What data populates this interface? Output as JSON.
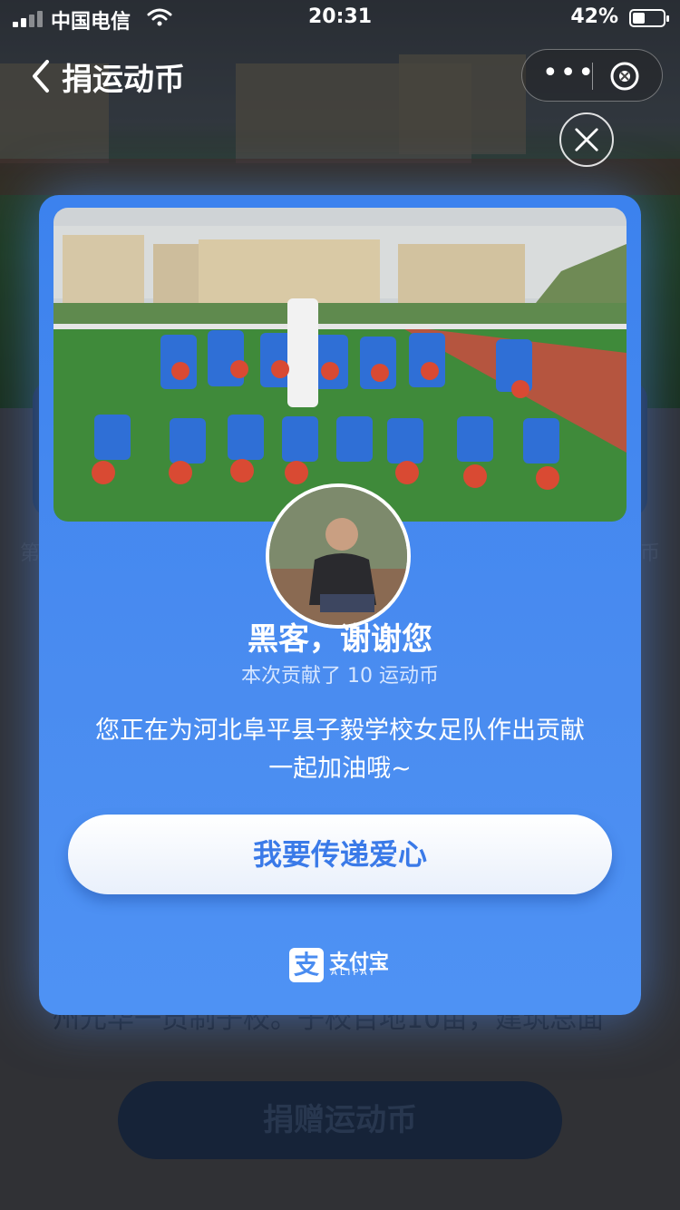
{
  "status_bar": {
    "carrier": "中国电信",
    "time": "20:31",
    "battery_percent": "42%",
    "battery_level": 0.42
  },
  "nav": {
    "title": "捐运动币",
    "back_icon": "chevron-left-icon",
    "more_icon": "more-dots-icon",
    "close_icon": "close-circle-icon"
  },
  "background": {
    "partial_text": "州元华一员制子校。子校百地10亩，建筑总面",
    "side_left": "第",
    "side_right": "币",
    "donate_button": "捐赠运动币"
  },
  "modal": {
    "close_icon": "close-icon",
    "thanks_title": "黑客，谢谢您",
    "contribution": "本次贡献了 10 运动币",
    "message_line1": "您正在为河北阜平县子毅学校女足队作出贡献",
    "message_line2": "一起加油哦~",
    "cta_button": "我要传递爱心",
    "brand_name": "支付宝",
    "brand_name_en": "ALIPAY",
    "brand_icon_char": "支"
  },
  "colors": {
    "modal_blue": "#4a8cf0",
    "button_text_blue": "#3a7ae8",
    "white": "#ffffff"
  }
}
